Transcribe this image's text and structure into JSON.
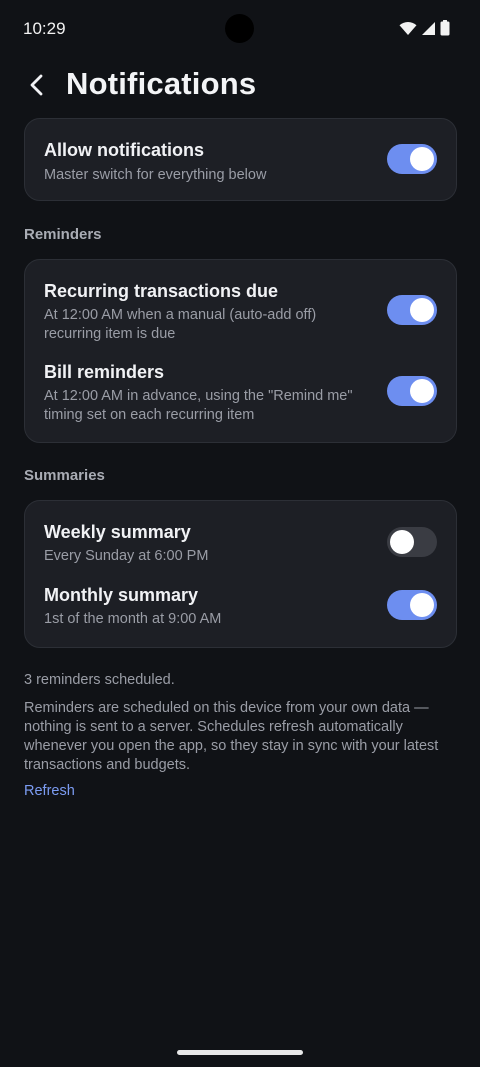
{
  "status_bar": {
    "time": "10:29",
    "icons": [
      "wifi-icon",
      "cell-signal-icon",
      "battery-icon"
    ]
  },
  "header": {
    "back_icon": "back-arrow-icon",
    "title": "Notifications"
  },
  "master": {
    "title": "Allow notifications",
    "subtitle": "Master switch for everything below",
    "enabled": true
  },
  "reminders": {
    "section_label": "Reminders",
    "items": [
      {
        "title": "Recurring transactions due",
        "subtitle": "At 12:00 AM when a manual (auto-add off) recurring item is due",
        "enabled": true
      },
      {
        "title": "Bill reminders",
        "subtitle": "At 12:00 AM in advance, using the \"Remind me\" timing set on each recurring item",
        "enabled": true
      }
    ]
  },
  "summaries": {
    "section_label": "Summaries",
    "items": [
      {
        "title": "Weekly summary",
        "subtitle": "Every Sunday at 6:00 PM",
        "enabled": false
      },
      {
        "title": "Monthly summary",
        "subtitle": "1st of the month at 9:00 AM",
        "enabled": true
      }
    ]
  },
  "footer": {
    "scheduled_count": "3 reminders scheduled.",
    "info": "Reminders are scheduled on this device from your own data — nothing is sent to a server. Schedules refresh automatically whenever you open the app, so they stay in sync with your latest transactions and budgets.",
    "refresh_label": "Refresh"
  },
  "colors": {
    "background": "#101216",
    "card": "#1d1f25",
    "toggle_on": "#6d8ef0",
    "toggle_off": "#3a3c43",
    "link": "#7c9cf2"
  }
}
